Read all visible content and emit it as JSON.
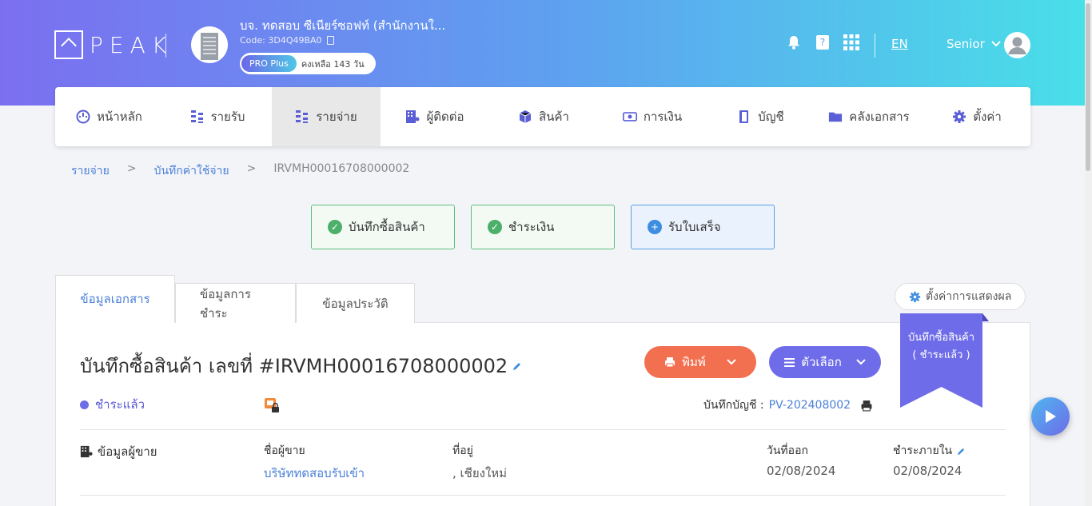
{
  "header": {
    "logo_text": "PEAK",
    "company_name": "บจ. ทดสอบ ซีเนียร์ซอฟท์ (สำนักงานใ...",
    "company_code": "Code: 3D4Q49BA0",
    "plan_tag": "PRO Plus",
    "plan_remaining": "คงเหลือ 143 วัน",
    "lang": "EN",
    "user_name": "Senior",
    "colors": {
      "gradient_start": "#7b6ff0",
      "gradient_end": "#48e0e8"
    }
  },
  "nav": {
    "items": [
      {
        "label": "หน้าหลัก",
        "icon": "gauge-icon"
      },
      {
        "label": "รายรับ",
        "icon": "coins-icon"
      },
      {
        "label": "รายจ่าย",
        "icon": "coins-icon",
        "active": true
      },
      {
        "label": "ผู้ติดต่อ",
        "icon": "building-icon"
      },
      {
        "label": "สินค้า",
        "icon": "box-icon"
      },
      {
        "label": "การเงิน",
        "icon": "money-icon"
      },
      {
        "label": "บัญชี",
        "icon": "book-icon"
      },
      {
        "label": "คลังเอกสาร",
        "icon": "folder-icon"
      },
      {
        "label": "ตั้งค่า",
        "icon": "gear-icon"
      }
    ]
  },
  "breadcrumb": {
    "items": [
      "รายจ่าย",
      "บันทึกค่าใช้จ่าย",
      "IRVMH00016708000002"
    ],
    "separator": ">"
  },
  "steps": [
    {
      "label": "บันทึกซื้อสินค้า",
      "state": "done"
    },
    {
      "label": "ชำระเงิน",
      "state": "done"
    },
    {
      "label": "รับใบเสร็จ",
      "state": "current"
    }
  ],
  "tabs": [
    "ข้อมูลเอกสาร",
    "ข้อมูลการชำระ",
    "ข้อมูลประวัติ"
  ],
  "settings_button": "ตั้งค่าการแสดงผล",
  "document": {
    "title": "บันทึกซื้อสินค้า เลขที่ #IRVMH00016708000002",
    "print_label": "พิมพ์",
    "options_label": "ตัวเลือก",
    "ribbon_line1": "บันทึกซื้อสินค้า",
    "ribbon_line2": "( ชำระแล้ว )",
    "status": "ชำระแล้ว",
    "journal_label": "บันทึกบัญชี :",
    "journal_link": "PV-202408002"
  },
  "vendor": {
    "section_label": "ข้อมูลผู้ขาย",
    "name_label": "ชื่อผู้ขาย",
    "name_value": "บริษัททดสอบรับเข้า",
    "address_label": "ที่อยู่",
    "address_value": ", เชียงใหม่",
    "issue_label": "วันที่ออก",
    "issue_value": "02/08/2024",
    "due_label": "ชำระภายใน",
    "due_value": "02/08/2024"
  }
}
